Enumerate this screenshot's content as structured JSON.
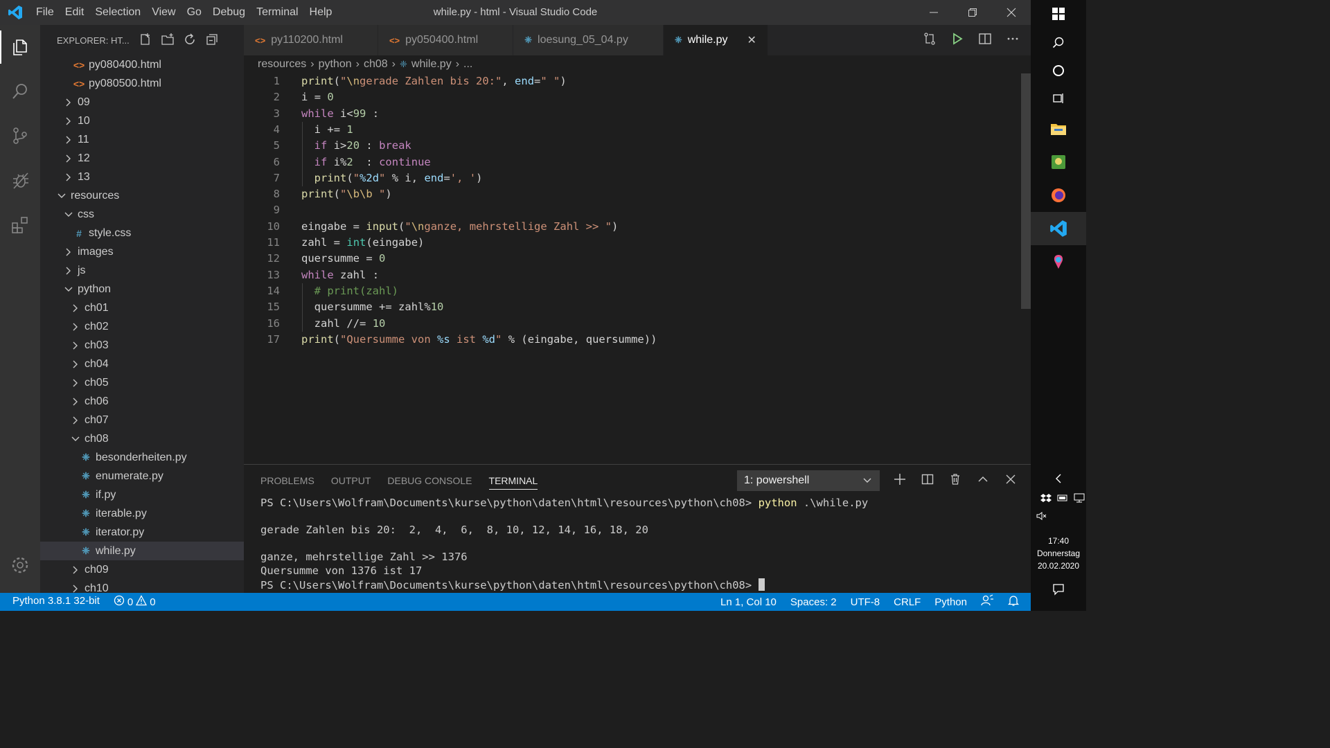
{
  "titlebar": {
    "menu": [
      "File",
      "Edit",
      "Selection",
      "View",
      "Go",
      "Debug",
      "Terminal",
      "Help"
    ],
    "title": "while.py - html - Visual Studio Code"
  },
  "sidebar": {
    "header": "EXPLORER: HT...",
    "items": [
      {
        "label": "py080400.html",
        "type": "html",
        "indent": 1
      },
      {
        "label": "py080500.html",
        "type": "html",
        "indent": 1
      },
      {
        "label": "09",
        "type": "folder",
        "indent": 0,
        "open": false
      },
      {
        "label": "10",
        "type": "folder",
        "indent": 0,
        "open": false
      },
      {
        "label": "11",
        "type": "folder",
        "indent": 0,
        "open": false
      },
      {
        "label": "12",
        "type": "folder",
        "indent": 0,
        "open": false
      },
      {
        "label": "13",
        "type": "folder",
        "indent": 0,
        "open": false
      },
      {
        "label": "resources",
        "type": "folder",
        "indent": -1,
        "open": true
      },
      {
        "label": "css",
        "type": "folder",
        "indent": 0,
        "open": true
      },
      {
        "label": "style.css",
        "type": "css",
        "indent": 1
      },
      {
        "label": "images",
        "type": "folder",
        "indent": 0,
        "open": false
      },
      {
        "label": "js",
        "type": "folder",
        "indent": 0,
        "open": false
      },
      {
        "label": "python",
        "type": "folder",
        "indent": 0,
        "open": true
      },
      {
        "label": "ch01",
        "type": "folder",
        "indent": 1,
        "open": false
      },
      {
        "label": "ch02",
        "type": "folder",
        "indent": 1,
        "open": false
      },
      {
        "label": "ch03",
        "type": "folder",
        "indent": 1,
        "open": false
      },
      {
        "label": "ch04",
        "type": "folder",
        "indent": 1,
        "open": false
      },
      {
        "label": "ch05",
        "type": "folder",
        "indent": 1,
        "open": false
      },
      {
        "label": "ch06",
        "type": "folder",
        "indent": 1,
        "open": false
      },
      {
        "label": "ch07",
        "type": "folder",
        "indent": 1,
        "open": false
      },
      {
        "label": "ch08",
        "type": "folder",
        "indent": 1,
        "open": true
      },
      {
        "label": "besonderheiten.py",
        "type": "py",
        "indent": 2
      },
      {
        "label": "enumerate.py",
        "type": "py",
        "indent": 2
      },
      {
        "label": "if.py",
        "type": "py",
        "indent": 2
      },
      {
        "label": "iterable.py",
        "type": "py",
        "indent": 2
      },
      {
        "label": "iterator.py",
        "type": "py",
        "indent": 2
      },
      {
        "label": "while.py",
        "type": "py",
        "indent": 2,
        "selected": true
      },
      {
        "label": "ch09",
        "type": "folder",
        "indent": 1,
        "open": false
      },
      {
        "label": "ch10",
        "type": "folder",
        "indent": 1,
        "open": false
      }
    ]
  },
  "tabs": [
    {
      "label": "py110200.html",
      "type": "html",
      "active": false
    },
    {
      "label": "py050400.html",
      "type": "html",
      "active": false
    },
    {
      "label": "loesung_05_04.py",
      "type": "py",
      "active": false
    },
    {
      "label": "while.py",
      "type": "py",
      "active": true
    }
  ],
  "breadcrumb": [
    "resources",
    "python",
    "ch08",
    "while.py",
    "..."
  ],
  "editor": {
    "lines": [
      "print(\"\\ngerade Zahlen bis 20:\", end=\" \")",
      "i = 0",
      "while i<99 :",
      "  i += 1",
      "  if i>20 : break",
      "  if i%2  : continue",
      "  print(\"%2d\" % i, end=', ')",
      "print(\"\\b\\b \")",
      "",
      "eingabe = input(\"\\nganze, mehrstellige Zahl >> \")",
      "zahl = int(eingabe)",
      "quersumme = 0",
      "while zahl :",
      "  # print(zahl)",
      "  quersumme += zahl%10",
      "  zahl //= 10",
      "print(\"Quersumme von %s ist %d\" % (eingabe, quersumme))"
    ]
  },
  "panel": {
    "tabs": [
      "PROBLEMS",
      "OUTPUT",
      "DEBUG CONSOLE",
      "TERMINAL"
    ],
    "active_tab": "TERMINAL",
    "shell": "1: powershell",
    "terminal": {
      "prompt1": "PS C:\\Users\\Wolfram\\Documents\\kurse\\python\\daten\\html\\resources\\python\\ch08> ",
      "cmd_name": "python",
      "cmd_arg": " .\\while.py",
      "out1": "gerade Zahlen bis 20:  2,  4,  6,  8, 10, 12, 14, 16, 18, 20",
      "out2": "ganze, mehrstellige Zahl >> 1376",
      "out3": "Quersumme von 1376 ist 17",
      "prompt2": "PS C:\\Users\\Wolfram\\Documents\\kurse\\python\\daten\\html\\resources\\python\\ch08> "
    }
  },
  "statusbar": {
    "interpreter": "Python 3.8.1 32-bit",
    "errors": "0",
    "warnings": "0",
    "position": "Ln 1, Col 10",
    "spaces": "Spaces: 2",
    "encoding": "UTF-8",
    "eol": "CRLF",
    "language": "Python"
  },
  "taskbar": {
    "time": "17:40",
    "day": "Donnerstag",
    "date": "20.02.2020"
  },
  "colors": {
    "accent": "#007acc",
    "keyword": "#c586c0",
    "function": "#dcdcaa",
    "string": "#ce9178",
    "number": "#b5cea8",
    "comment": "#6a9955"
  }
}
